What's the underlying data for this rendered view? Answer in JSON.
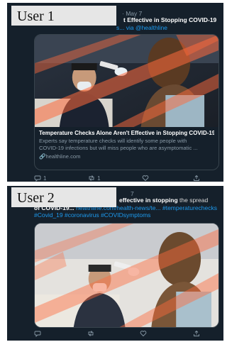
{
  "user1": {
    "label": "User 1",
    "date": "· May 7",
    "headline": "t Effective in Stopping COVID-19",
    "link_line": "s... via",
    "via_handle": "@healthline",
    "card": {
      "title": "Temperature Checks Alone Aren't Effective in Stopping COVID-19...",
      "desc_line1": "Experts say temperature checks will identify some people with",
      "desc_line2": "COVID-19 infections but will miss people who are asymptomatic ...",
      "domain": "healthline.com"
    },
    "actions": {
      "reply": "1",
      "retweet": "1",
      "like": "",
      "share": ""
    }
  },
  "user2": {
    "label": "User 2",
    "date": "7",
    "text_pre": "effective in stopping",
    "text_bold": "the spread",
    "line2_bold": "of COVID-19...",
    "line2_link": "healthline.com/health-news/te...",
    "line2_tag": "#temperaturechecks",
    "line3_tag1": "#Covid_19",
    "line3_tag2": "#coronavirus",
    "line3_tag3": "#COVIDsymptoms",
    "actions": {
      "reply": "",
      "retweet": "",
      "like": "",
      "share": ""
    }
  },
  "icons": [
    "reply-icon",
    "retweet-icon",
    "like-icon",
    "share-icon",
    "link-icon"
  ],
  "colors": {
    "background": "#15202b",
    "link": "#1d9bf0",
    "muted": "#8899a6",
    "overlay_orange": "#ff6a3c"
  }
}
